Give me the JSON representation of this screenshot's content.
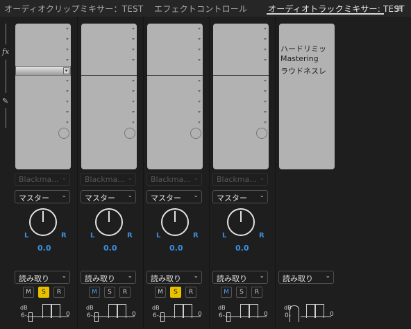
{
  "tabs": [
    {
      "label": "オーディオクリップミキサー：TEST"
    },
    {
      "label": "エフェクトコントロール"
    },
    {
      "label": "オーディオトラックミキサー: TEST"
    }
  ],
  "menu_icon": "hamburger-menu-icon",
  "rail": {
    "fx_label": "fx",
    "pen_icon": "pen-icon"
  },
  "tracks": [
    {
      "input": "Blackma...",
      "output": "マスター",
      "pan_l": "L",
      "pan_r": "R",
      "pan_value": "0.0",
      "automation": "読み取り",
      "m": "M",
      "s": "S",
      "r": "R",
      "db_label": "dB",
      "db_scale": "6-",
      "db_zero": "0",
      "mute_active": false,
      "solo_active": true
    },
    {
      "input": "Blackma...",
      "output": "マスター",
      "pan_l": "L",
      "pan_r": "R",
      "pan_value": "0.0",
      "automation": "読み取り",
      "m": "M",
      "s": "S",
      "r": "R",
      "db_label": "dB",
      "db_scale": "6-",
      "db_zero": "0",
      "mute_active": true,
      "solo_active": false
    },
    {
      "input": "Blackma...",
      "output": "マスター",
      "pan_l": "L",
      "pan_r": "R",
      "pan_value": "0.0",
      "automation": "読み取り",
      "m": "M",
      "s": "S",
      "r": "R",
      "db_label": "dB",
      "db_scale": "6-",
      "db_zero": "0",
      "mute_active": false,
      "solo_active": true
    },
    {
      "input": "Blackma...",
      "output": "マスター",
      "pan_l": "L",
      "pan_r": "R",
      "pan_value": "0.0",
      "automation": "読み取り",
      "m": "M",
      "s": "S",
      "r": "R",
      "db_label": "dB",
      "db_scale": "6-",
      "db_zero": "0",
      "mute_active": true,
      "solo_active": false
    }
  ],
  "master": {
    "effects": [
      "ハードリミッ",
      "Mastering",
      "ラウドネスレ"
    ],
    "automation": "読み取り",
    "db_label": "dB",
    "db_scale": "0-",
    "db_zero": "0"
  },
  "colors": {
    "accent_blue": "#3a8fe0",
    "solo_yellow": "#e8c000"
  }
}
